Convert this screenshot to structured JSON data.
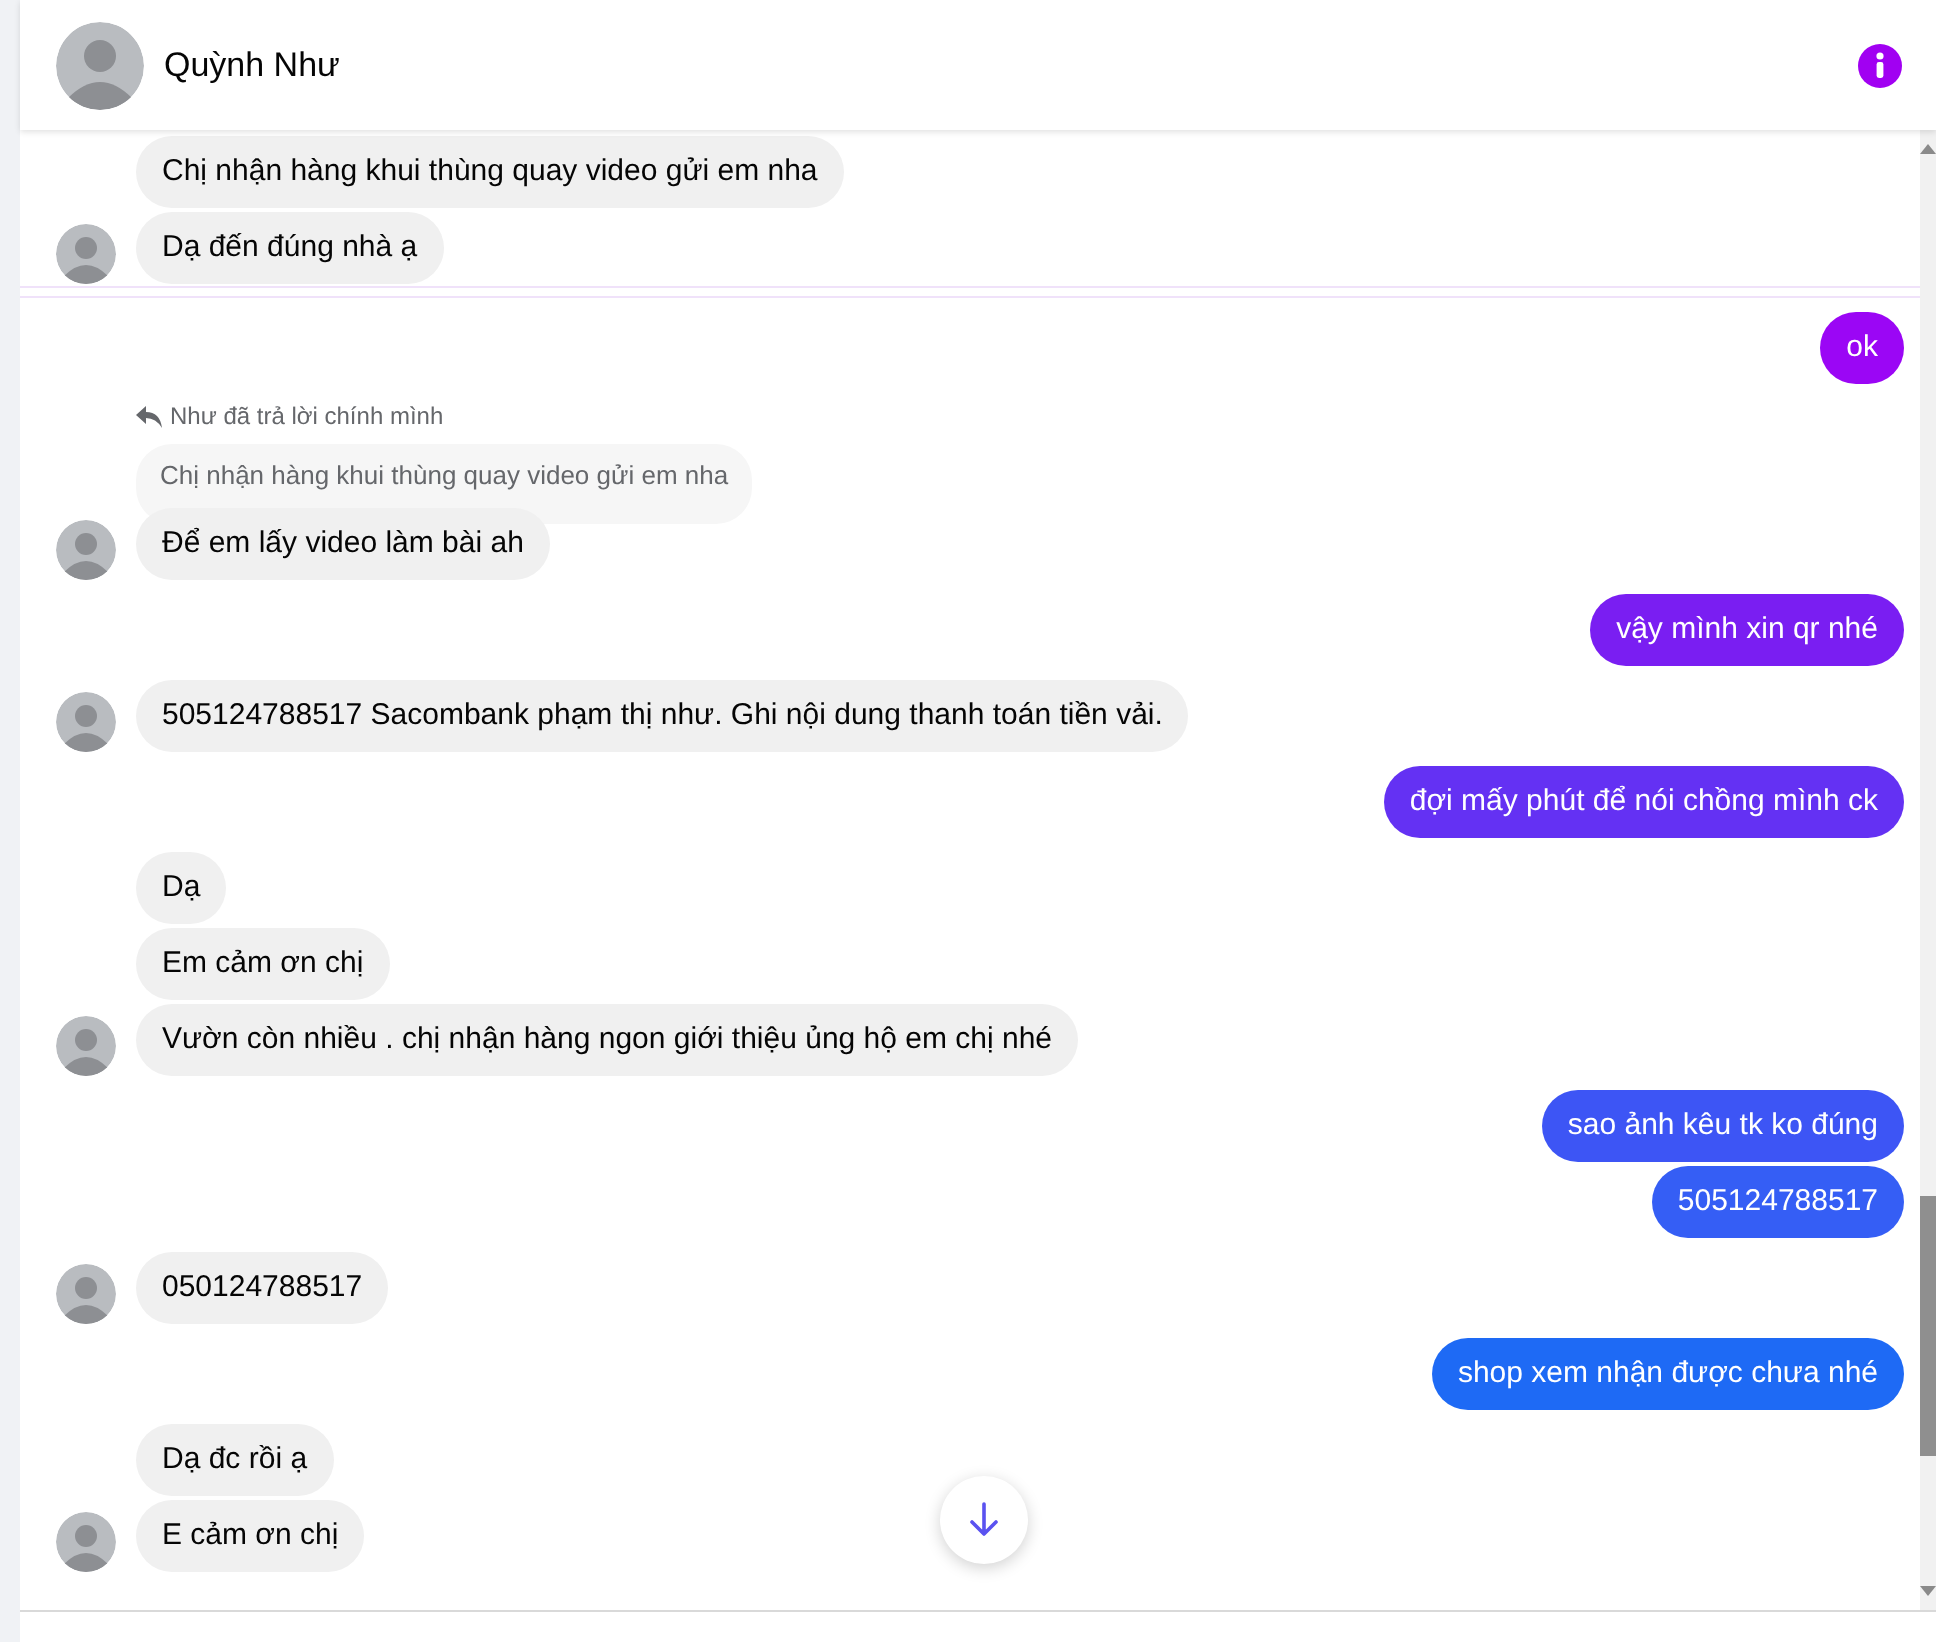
{
  "header": {
    "name": "Quỳnh Như"
  },
  "groups": [
    {
      "kind": "incoming",
      "messages": [
        {
          "text": "Chị nhận hàng khui thùng quay video gửi em nha"
        },
        {
          "text": "Dạ đến đúng nhà ạ"
        }
      ]
    },
    {
      "kind": "divider"
    },
    {
      "kind": "outgoing",
      "messages": [
        {
          "text": "ok",
          "color": "#9b06f5"
        }
      ]
    },
    {
      "kind": "incoming",
      "reply": {
        "label": "Như đã trả lời chính mình",
        "quote": "Chị nhận hàng khui thùng quay video gửi em nha"
      },
      "messages": [
        {
          "text": "Để em lấy video làm bài ah"
        }
      ]
    },
    {
      "kind": "outgoing",
      "messages": [
        {
          "text": "vậy mình xin qr nhé",
          "color": "#7a1ef2"
        }
      ]
    },
    {
      "kind": "incoming",
      "messages": [
        {
          "text": "505124788517 Sacombank phạm thị như. Ghi nội dung thanh toán tiền vải."
        }
      ]
    },
    {
      "kind": "outgoing",
      "messages": [
        {
          "text": "đợi mấy phút để nói chồng mình ck",
          "color": "#6431f3"
        }
      ]
    },
    {
      "kind": "incoming",
      "messages": [
        {
          "text": "Dạ"
        },
        {
          "text": "Em cảm ơn chị"
        },
        {
          "text": "Vườn còn nhiều . chị nhận hàng ngon giới thiệu ủng hộ em chị nhé"
        }
      ]
    },
    {
      "kind": "outgoing",
      "messages": [
        {
          "text": "sao ảnh kêu tk ko đúng",
          "color": "#3d55f5"
        },
        {
          "text": "505124788517",
          "color": "#355ef5"
        }
      ]
    },
    {
      "kind": "incoming",
      "messages": [
        {
          "text": "050124788517"
        }
      ]
    },
    {
      "kind": "outgoing",
      "messages": [
        {
          "text": "shop xem nhận được chưa nhé",
          "color": "#1e6af5"
        }
      ]
    },
    {
      "kind": "incoming",
      "messages": [
        {
          "text": "Dạ đc rồi ạ"
        },
        {
          "text": "E cảm ơn chị"
        }
      ]
    }
  ]
}
